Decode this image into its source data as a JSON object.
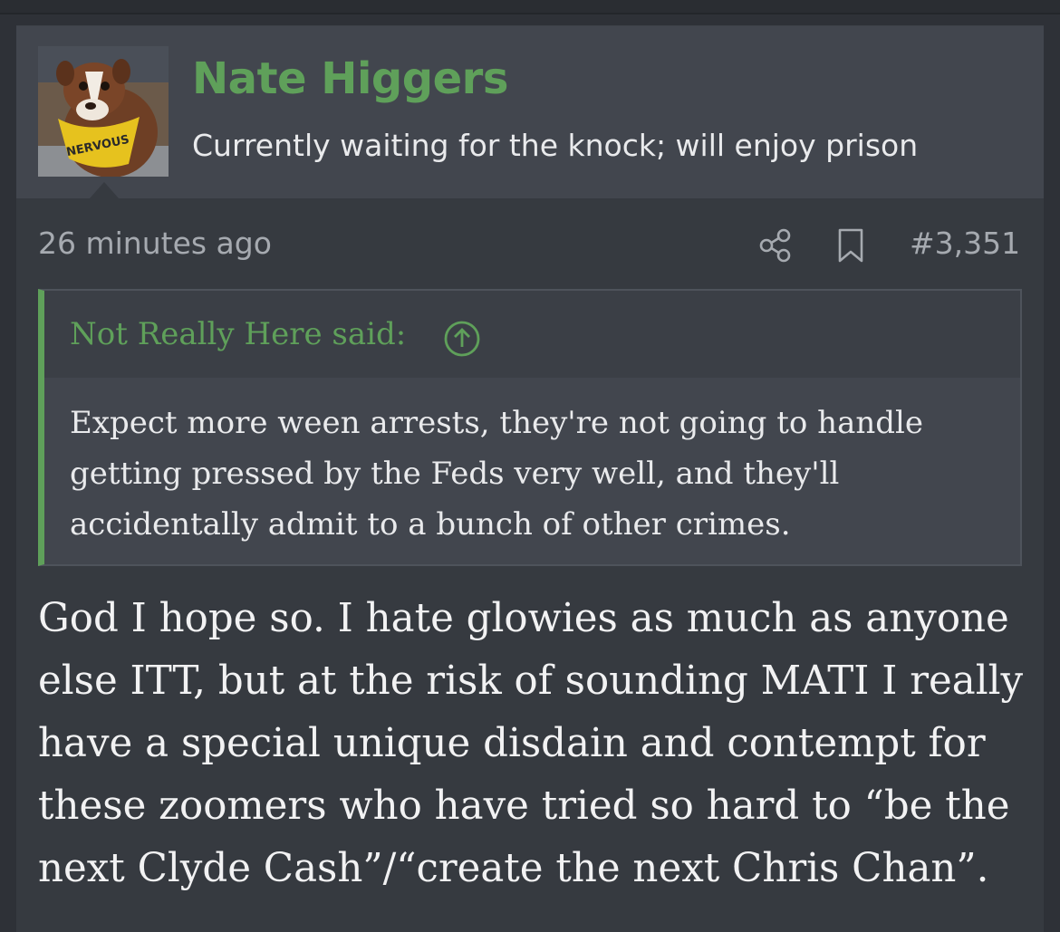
{
  "post": {
    "username": "Nate Higgers",
    "user_title": "Currently waiting for the knock; will enjoy prison",
    "avatar_badge": "NERVOUS",
    "timestamp": "26 minutes ago",
    "post_number": "#3,351",
    "icons": [
      "share-icon",
      "bookmark-icon",
      "arrow-up-circle-icon"
    ],
    "colors": {
      "accent": "#5fa05a",
      "header_bg": "#42464e",
      "post_bg": "#363a40"
    }
  },
  "quote": {
    "author_line": "Not Really Here said:",
    "body": "Expect more ween arrests, they're not going to handle getting pressed by the Feds very well, and they'll accidentally admit to a bunch of other crimes."
  },
  "reply": {
    "body": "God I hope so. I hate glowies as much as anyone else ITT, but at the risk of sounding MATI I really have a special unique disdain and contempt for these zoomers who have tried so hard to “be the next Clyde Cash”/“create the next Chris Chan”."
  }
}
